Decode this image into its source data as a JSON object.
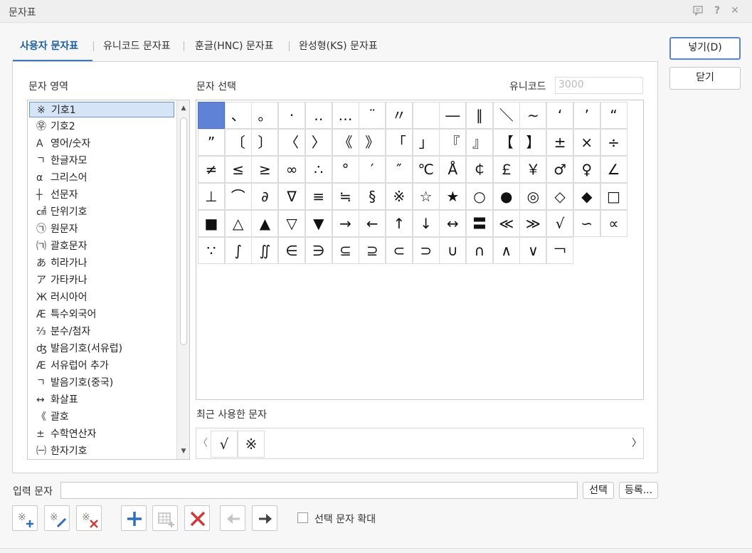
{
  "window": {
    "title": "문자표"
  },
  "tabs": [
    {
      "label": "사용자 문자표"
    },
    {
      "label": "유니코드 문자표"
    },
    {
      "label": "훈글(HNC) 문자표"
    },
    {
      "label": "완성형(KS) 문자표"
    }
  ],
  "buttons": {
    "insert": "넣기(D)",
    "close": "닫기",
    "select": "선택",
    "register": "등록..."
  },
  "labels": {
    "region": "문자 영역",
    "select_char": "문자 선택",
    "unicode": "유니코드",
    "recent": "최근 사용한 문자",
    "input_char": "입력 문자",
    "enlarge": "선택 문자 확대"
  },
  "unicode_value": "3000",
  "list": [
    {
      "icon": "※",
      "label": "기호1"
    },
    {
      "icon": "㉾",
      "label": "기호2"
    },
    {
      "icon": "A",
      "label": "영어/숫자"
    },
    {
      "icon": "ㄱ",
      "label": "한글자모"
    },
    {
      "icon": "α",
      "label": "그리스어"
    },
    {
      "icon": "┼",
      "label": "선문자"
    },
    {
      "icon": "㎠",
      "label": "단위기호"
    },
    {
      "icon": "㉠",
      "label": "원문자"
    },
    {
      "icon": "㈀",
      "label": "괄호문자"
    },
    {
      "icon": "あ",
      "label": "히라가나"
    },
    {
      "icon": "ア",
      "label": "가타카나"
    },
    {
      "icon": "Ж",
      "label": "러시아어"
    },
    {
      "icon": "Æ",
      "label": "특수외국어"
    },
    {
      "icon": "⅔",
      "label": "분수/첨자"
    },
    {
      "icon": "ʤ",
      "label": "발음기호(서유럽)"
    },
    {
      "icon": "Æ",
      "label": "서유럽어 추가"
    },
    {
      "icon": "ㄱ",
      "label": "발음기호(중국)"
    },
    {
      "icon": "↔",
      "label": "화살표"
    },
    {
      "icon": "《",
      "label": "괄호"
    },
    {
      "icon": "±",
      "label": "수학연산자"
    },
    {
      "icon": "㈠",
      "label": "한자기호"
    }
  ],
  "chars": [
    [
      " ",
      "、",
      "。",
      "·",
      "‥",
      "…",
      "¨",
      "〃",
      " ",
      "―",
      "∥",
      "＼",
      "∼",
      "‘",
      "’",
      "“"
    ],
    [
      "”",
      "〔",
      "〕",
      "〈",
      "〉",
      "《",
      "》",
      "「",
      "」",
      "『",
      "』",
      "【",
      "】",
      "±",
      "×",
      "÷"
    ],
    [
      "≠",
      "≤",
      "≥",
      "∞",
      "∴",
      "°",
      "′",
      "″",
      "℃",
      "Å",
      "￠",
      "￡",
      "￥",
      "♂",
      "♀",
      "∠"
    ],
    [
      "⊥",
      "⌒",
      "∂",
      "∇",
      "≡",
      "≒",
      "§",
      "※",
      "☆",
      "★",
      "○",
      "●",
      "◎",
      "◇",
      "◆",
      "□"
    ],
    [
      "■",
      "△",
      "▲",
      "▽",
      "▼",
      "→",
      "←",
      "↑",
      "↓",
      "↔",
      "〓",
      "≪",
      "≫",
      "√",
      "∽",
      "∝"
    ],
    [
      "∵",
      "∫",
      "∬",
      "∈",
      "∋",
      "⊆",
      "⊇",
      "⊂",
      "⊃",
      "∪",
      "∩",
      "∧",
      "∨",
      "￢"
    ]
  ],
  "recent": [
    "√",
    "※"
  ],
  "input_value": ""
}
